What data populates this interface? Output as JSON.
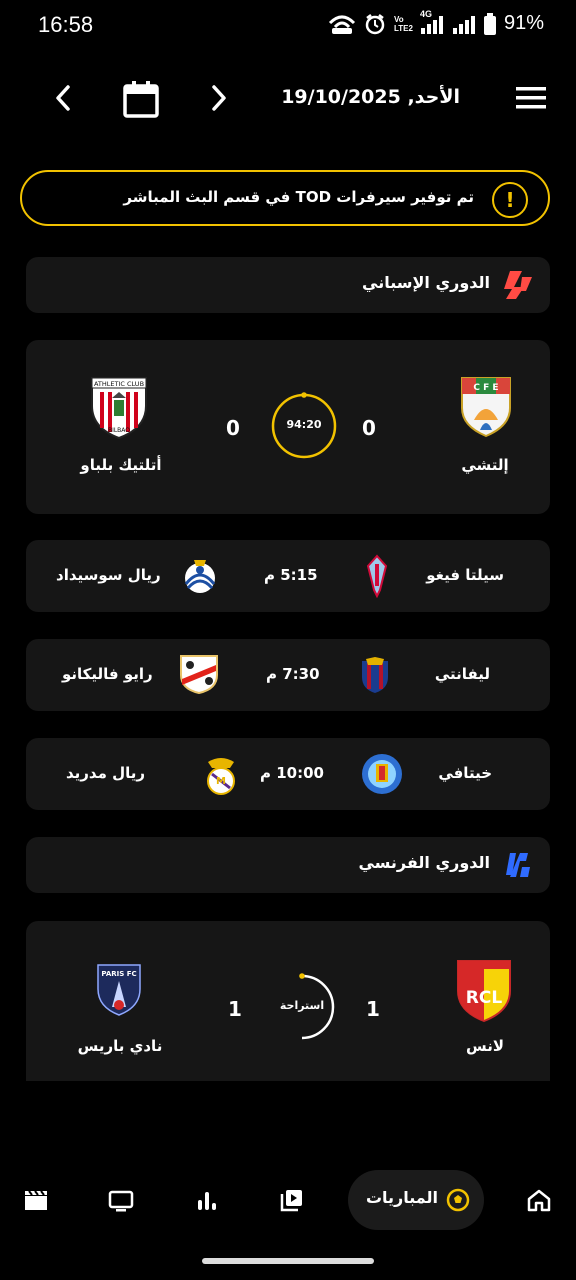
{
  "status_bar": {
    "time": "16:58",
    "battery": "91%",
    "network": "4G",
    "volte": "Vo LTE2"
  },
  "header": {
    "date": "الأحد, 19/10/2025",
    "icons": [
      "chevron-left-icon",
      "calendar-icon",
      "chevron-right-icon",
      "menu-icon"
    ]
  },
  "notice": {
    "text": "تم توفير سيرفرات TOD في قسم البث المباشر",
    "icon_text": "!"
  },
  "leagues": [
    {
      "name": "الدوري الإسباني",
      "live_match": {
        "home": "إلتشي",
        "home_score": "0",
        "away": "أتلتيك بلباو",
        "away_score": "0",
        "clock": "94:20",
        "progress": 0.99
      },
      "fixtures": [
        {
          "home": "سيلتا فيغو",
          "time": "5:15 م",
          "away": "ريال سوسيداد"
        },
        {
          "home": "ليفانتي",
          "time": "7:30 م",
          "away": "رايو فاليكانو"
        },
        {
          "home": "خيتافي",
          "time": "10:00 م",
          "away": "ريال مدريد"
        }
      ]
    },
    {
      "name": "الدوري الفرنسي",
      "live_match": {
        "home": "لانس",
        "home_score": "1",
        "away": "نادي باريس",
        "away_score": "1",
        "clock": "استراحة",
        "progress": 0.5
      }
    }
  ],
  "badges": {
    "elche_letters": "C F E",
    "athletic_text": "ATHLETIC CLUB",
    "athletic_bottom": "BILBAO",
    "rcl_text": "RCL",
    "paris_text": "PARIS FC"
  },
  "bottom_nav": {
    "active_label": "المباريات",
    "items": [
      "home-icon",
      "ball-icon",
      "video-library-icon",
      "stats-icon",
      "tv-icon",
      "clapper-icon"
    ]
  },
  "colors": {
    "accent": "#f2c200",
    "card": "#161616",
    "background": "#000000"
  }
}
